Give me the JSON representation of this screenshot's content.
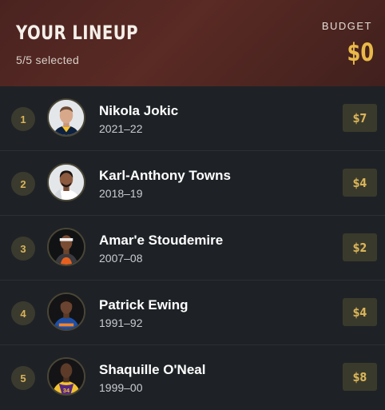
{
  "header": {
    "title": "YOUR LINEUP",
    "selected_text": "5/5 selected",
    "budget_label": "BUDGET",
    "budget_value": "$0"
  },
  "colors": {
    "accent_gold": "#e9b949",
    "header_maroon": "#4a2320",
    "page_background": "#1e2226"
  },
  "lineup": [
    {
      "rank": "1",
      "name": "Nikola Jokic",
      "season": "2021–22",
      "cost": "$7",
      "avatar": "player-avatar-nuggets"
    },
    {
      "rank": "2",
      "name": "Karl-Anthony Towns",
      "season": "2018–19",
      "cost": "$4",
      "avatar": "player-avatar-timberwolves"
    },
    {
      "rank": "3",
      "name": "Amar'e Stoudemire",
      "season": "2007–08",
      "cost": "$2",
      "avatar": "player-avatar-suns"
    },
    {
      "rank": "4",
      "name": "Patrick Ewing",
      "season": "1991–92",
      "cost": "$4",
      "avatar": "player-avatar-knicks"
    },
    {
      "rank": "5",
      "name": "Shaquille O'Neal",
      "season": "1999–00",
      "cost": "$8",
      "avatar": "player-avatar-lakers"
    }
  ]
}
